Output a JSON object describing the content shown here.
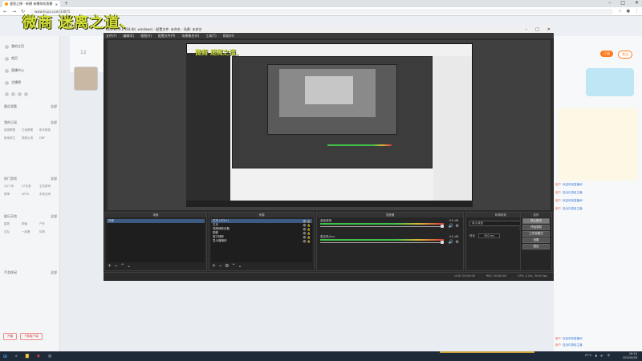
{
  "browser": {
    "tab_title": "速直之撲 - 新播 来播你前直播",
    "new_tab": "+",
    "url": "www.huya.com/14875",
    "window_controls": [
      "–",
      "□",
      "✕"
    ]
  },
  "overlay": {
    "title": "微商 迷离之道、"
  },
  "sidebar": {
    "items": [
      {
        "label": "我的主页"
      },
      {
        "label": "首页"
      },
      {
        "label": "直播中心"
      },
      {
        "label": "主播榜"
      }
    ],
    "sections": [
      {
        "title": "最近观看",
        "more": "全部"
      },
      {
        "title": "我的订阅",
        "more": "全部"
      },
      {
        "title": "热门游戏",
        "more": "全部"
      },
      {
        "title": "娱乐天地",
        "more": "全部"
      },
      {
        "title": "手游休闲",
        "more": "全部"
      }
    ],
    "grid_labels": [
      "英雄联盟",
      "王者荣耀",
      "和平精英",
      "绝地求生",
      "穿越火线",
      "DNF",
      "QQ飞车",
      "CF手游",
      "主机游戏",
      "原神",
      "APEX",
      "永劫无间",
      "星秀",
      "颜值",
      "户外",
      "交友",
      "一起看",
      "体育"
    ],
    "buttons": [
      "开播",
      "下载客户端"
    ]
  },
  "page": {
    "room_count": "12"
  },
  "right_panel": {
    "badges": [
      "订阅",
      "关注"
    ],
    "chat": [
      {
        "user": "用户",
        "text": "欢迎来到直播间"
      },
      {
        "user": "用户",
        "text": "送出礼物给主播"
      },
      {
        "user": "用户",
        "text": "欢迎来到直播间"
      },
      {
        "user": "用户",
        "text": "送出礼物给主播"
      },
      {
        "user": "用户",
        "text": "欢迎来到直播间"
      },
      {
        "user": "用户",
        "text": "送出礼物给主播"
      }
    ]
  },
  "obs": {
    "title": "OBS 27.0.0 (64-bit, windows) - 配置文件: 未命名 - 场景: 未命名",
    "menu": [
      "文件(F)",
      "编辑(E)",
      "视图(V)",
      "配置文件(P)",
      "场景集合(S)",
      "工具(T)",
      "帮助(H)"
    ],
    "preview_title": "微商 迷离之道、",
    "docks": {
      "scenes": {
        "title": "场景",
        "items": [
          "场景"
        ]
      },
      "sources": {
        "title": "来源",
        "items": [
          "文本 (GDI+)",
          "文本",
          "视频捕获设备",
          "图像",
          "窗口捕获",
          "显示器捕获"
        ]
      },
      "mixer": {
        "title": "混音器",
        "rows": [
          {
            "name": "桌面音频",
            "db": "0.0 dB"
          },
          {
            "name": "麦克风/Aux",
            "db": "0.0 dB"
          }
        ]
      },
      "transitions": {
        "title": "转场特效",
        "type": "淡入淡出",
        "duration_label": "时长",
        "duration": "300 ms"
      },
      "controls": {
        "title": "控件",
        "buttons": [
          "停止推流",
          "开始录制",
          "工作室模式",
          "设置",
          "退出"
        ]
      }
    },
    "status": {
      "live": "LIVE: 00:00:00",
      "rec": "REC: 00:00:00",
      "cpu": "CPU: 2.4%, 30.00 fps"
    }
  },
  "taskbar": {
    "time": "16:10",
    "date": "2022/9/28",
    "temp": "27°C",
    "ime": "中"
  }
}
